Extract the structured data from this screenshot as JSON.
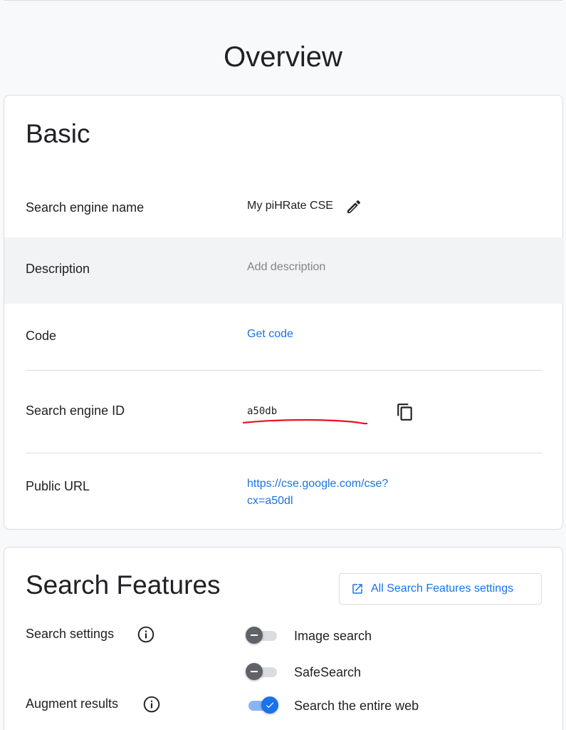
{
  "page": {
    "title": "Overview"
  },
  "basic": {
    "title": "Basic",
    "name": {
      "label": "Search engine name",
      "value": "My piHRate CSE"
    },
    "description": {
      "label": "Description",
      "placeholder": "Add description"
    },
    "code": {
      "label": "Code",
      "link": "Get code"
    },
    "engine_id": {
      "label": "Search engine ID",
      "value": "a50db"
    },
    "public_url": {
      "label": "Public URL",
      "line1": "https://cse.google.com/cse?",
      "line2": "cx=a50dl"
    }
  },
  "features": {
    "title": "Search Features",
    "all_settings_button": "All Search Features settings",
    "search_settings_label": "Search settings",
    "augment_results_label": "Augment results",
    "toggles": [
      {
        "label": "Image search",
        "on": false
      },
      {
        "label": "SafeSearch",
        "on": false
      },
      {
        "label": "Search the entire web",
        "on": true
      }
    ]
  },
  "colors": {
    "accent": "#1a73e8",
    "annotation": "#e8121e"
  }
}
